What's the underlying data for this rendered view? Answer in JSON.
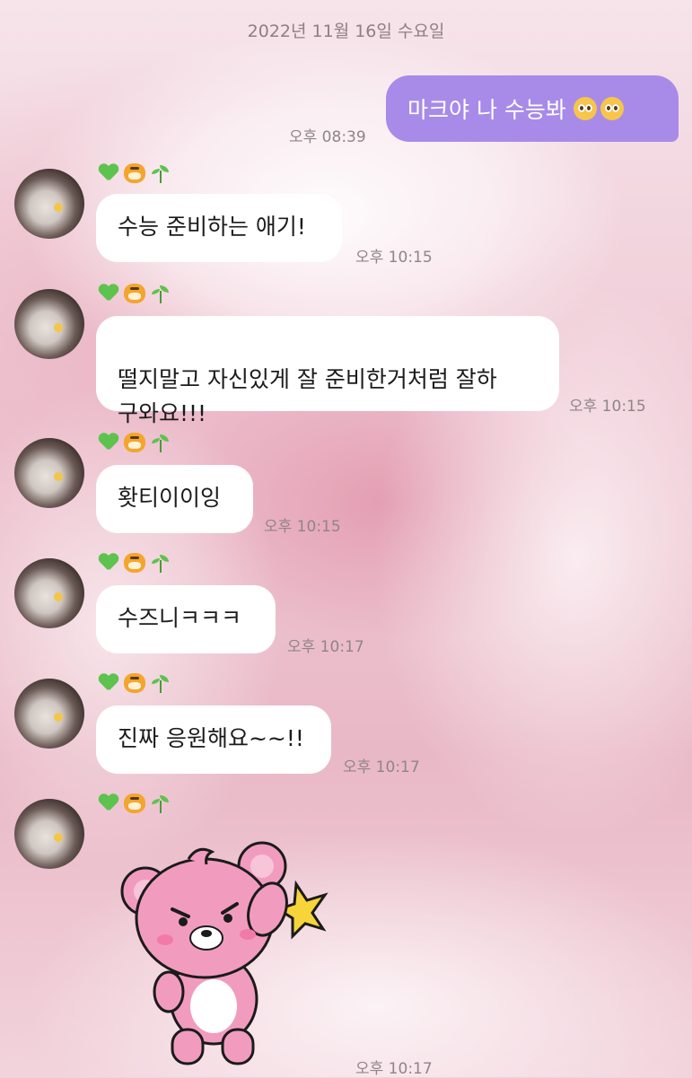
{
  "date_header": "2022년 11월 16일 수요일",
  "outgoing": {
    "text": "마크야 나 수능봐",
    "emoji_icons": [
      "pleading-face-icon",
      "pleading-face-icon"
    ],
    "time": "오후 08:39",
    "bubble_color": "#a88be8"
  },
  "incoming": [
    {
      "text": "수능 준비하는 애기!",
      "time": "오후 10:15"
    },
    {
      "text": "떨지말고 자신있게 잘 준비한거처럼 잘하\n구와요!!!",
      "time": "오후 10:15"
    },
    {
      "text": "홧티이이잉",
      "time": "오후 10:15"
    },
    {
      "text": "수즈니ㅋㅋㅋ",
      "time": "오후 10:17"
    },
    {
      "text": "진짜 응원해요~~!!",
      "time": "오후 10:17"
    },
    {
      "sticker": "pink-bear-salute-sticker",
      "time": "오후 10:17"
    }
  ],
  "badge_icons": [
    "green-heart-icon",
    "tiger-face-icon",
    "seedling-icon"
  ]
}
